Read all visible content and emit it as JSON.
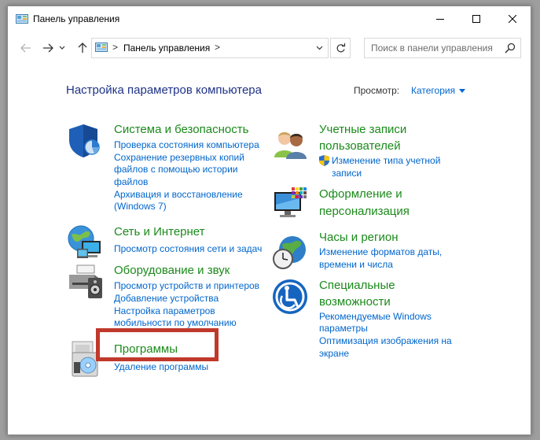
{
  "window": {
    "title": "Панель управления"
  },
  "titlebar_buttons": [
    "minimize-button",
    "maximize-button",
    "close-button"
  ],
  "address": {
    "crumb": "Панель управления",
    "separator": ">"
  },
  "search": {
    "placeholder": "Поиск в панели управления"
  },
  "page": {
    "heading": "Настройка параметров компьютера",
    "view_label": "Просмотр:",
    "view_value": "Категория"
  },
  "categories": {
    "security": {
      "title": "Система и безопасность",
      "links": [
        "Проверка состояния компьютера",
        "Сохранение резервных копий",
        "файлов с помощью истории",
        "файлов",
        "Архивация и восстановление",
        "(Windows 7)"
      ]
    },
    "network": {
      "title": "Сеть и Интернет",
      "links": [
        "Просмотр состояния сети и задач"
      ]
    },
    "hardware": {
      "title": "Оборудование и звук",
      "links": [
        "Просмотр устройств и принтеров",
        "Добавление устройства",
        "Настройка параметров",
        "мобильности по умолчанию"
      ]
    },
    "programs": {
      "title": "Программы",
      "links": [
        "Удаление программы"
      ]
    },
    "accounts": {
      "title_line1": "Учетные записи",
      "title_line2": "пользователей",
      "links": [
        "Изменение типа учетной",
        "записи"
      ]
    },
    "appearance": {
      "title_line1": "Оформление и",
      "title_line2": "персонализация"
    },
    "clock": {
      "title": "Часы и регион",
      "links": [
        "Изменение форматов даты,",
        "времени и числа"
      ]
    },
    "ease": {
      "title_line1": "Специальные",
      "title_line2": "возможности",
      "links": [
        "Рекомендуемые Windows",
        "параметры",
        "Оптимизация изображения на",
        "экране"
      ]
    }
  },
  "colors": {
    "heading": "#1e3287",
    "category_title": "#1b8a1b",
    "link": "#0066cc",
    "highlight": "#c0392b"
  }
}
